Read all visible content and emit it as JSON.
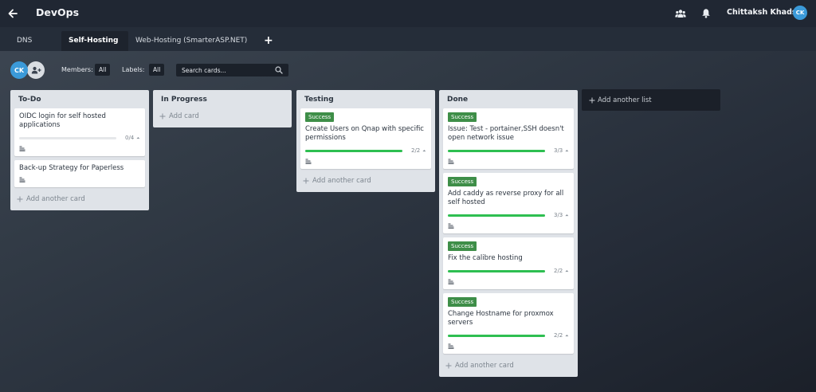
{
  "app": {
    "board_title": "DevOps",
    "user_name": "Chittaksh Khadse",
    "user_initials": "CK"
  },
  "tabs": [
    {
      "label": "DNS",
      "active": false
    },
    {
      "label": "Self-Hosting",
      "active": true
    },
    {
      "label": "Web-Hosting (SmarterASP.NET)",
      "active": false
    }
  ],
  "add_tab_label": "+",
  "filters": {
    "member_initials": "CK",
    "members_label": "Members:",
    "members_value": "All",
    "labels_label": "Labels:",
    "labels_value": "All",
    "search_placeholder": "Search cards..."
  },
  "lists": [
    {
      "title": "To-Do",
      "cards": [
        {
          "label": "",
          "title": "OIDC login for self hosted applications",
          "progress": "0/4",
          "done": 0,
          "total": 4
        },
        {
          "label": "",
          "title": "Back-up Strategy for Paperless",
          "progress": "",
          "done": 0,
          "total": 0
        }
      ],
      "add_card": "Add another card"
    },
    {
      "title": "In Progress",
      "cards": [],
      "add_card": "Add card"
    },
    {
      "title": "Testing",
      "cards": [
        {
          "label": "Success",
          "title": "Create Users on Qnap with specific permissions",
          "progress": "2/2",
          "done": 2,
          "total": 2
        }
      ],
      "add_card": "Add another card"
    },
    {
      "title": "Done",
      "cards": [
        {
          "label": "Success",
          "title": "Issue: Test - portainer,SSH doesn't open network issue",
          "progress": "3/3",
          "done": 3,
          "total": 3
        },
        {
          "label": "Success",
          "title": "Add caddy as reverse proxy for all self hosted",
          "progress": "3/3",
          "done": 3,
          "total": 3
        },
        {
          "label": "Success",
          "title": "Fix the calibre hosting",
          "progress": "2/2",
          "done": 2,
          "total": 2
        },
        {
          "label": "Success",
          "title": "Change Hostname for proxmox servers",
          "progress": "2/2",
          "done": 2,
          "total": 2
        }
      ],
      "add_card": "Add another card"
    }
  ],
  "add_list": "Add another list",
  "colors": {
    "label_success": "#3e8e48",
    "progress_fill": "#2ebf51",
    "avatar": "#3b9ad9"
  },
  "icons": [
    "back-arrow-icon",
    "team-icon",
    "bell-icon",
    "add-member-icon",
    "search-icon",
    "description-icon",
    "caret-up-icon",
    "plus-icon"
  ]
}
